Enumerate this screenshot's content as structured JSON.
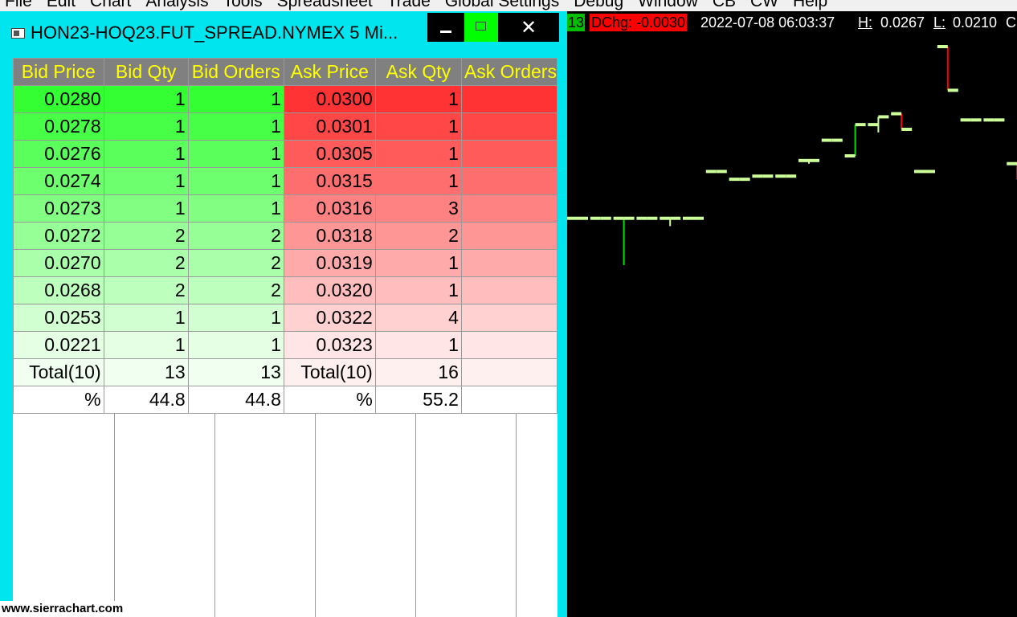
{
  "menu": [
    "File",
    "Edit",
    "Chart",
    "Analysis",
    "Tools",
    "Spreadsheet",
    "Trade",
    "Global Settings",
    "Debug",
    "Window",
    "CB",
    "CW",
    "Help"
  ],
  "window": {
    "title": "HON23-HOQ23.FUT_SPREAD.NYMEX  5 Mi...",
    "close_glyph": "✕"
  },
  "dom": {
    "headers": [
      "Bid Price",
      "Bid Qty",
      "Bid Orders",
      "Ask Price",
      "Ask Qty",
      "Ask Orders"
    ],
    "rows": [
      {
        "bid_price": "0.0280",
        "bid_qty": "1",
        "bid_orders": "1",
        "ask_price": "0.0300",
        "ask_qty": "1"
      },
      {
        "bid_price": "0.0278",
        "bid_qty": "1",
        "bid_orders": "1",
        "ask_price": "0.0301",
        "ask_qty": "1"
      },
      {
        "bid_price": "0.0276",
        "bid_qty": "1",
        "bid_orders": "1",
        "ask_price": "0.0305",
        "ask_qty": "1"
      },
      {
        "bid_price": "0.0274",
        "bid_qty": "1",
        "bid_orders": "1",
        "ask_price": "0.0315",
        "ask_qty": "1"
      },
      {
        "bid_price": "0.0273",
        "bid_qty": "1",
        "bid_orders": "1",
        "ask_price": "0.0316",
        "ask_qty": "3"
      },
      {
        "bid_price": "0.0272",
        "bid_qty": "2",
        "bid_orders": "2",
        "ask_price": "0.0318",
        "ask_qty": "2"
      },
      {
        "bid_price": "0.0270",
        "bid_qty": "2",
        "bid_orders": "2",
        "ask_price": "0.0319",
        "ask_qty": "1"
      },
      {
        "bid_price": "0.0268",
        "bid_qty": "2",
        "bid_orders": "2",
        "ask_price": "0.0320",
        "ask_qty": "1"
      },
      {
        "bid_price": "0.0253",
        "bid_qty": "1",
        "bid_orders": "1",
        "ask_price": "0.0322",
        "ask_qty": "4"
      },
      {
        "bid_price": "0.0221",
        "bid_qty": "1",
        "bid_orders": "1",
        "ask_price": "0.0323",
        "ask_qty": "1"
      }
    ],
    "total_row": {
      "bid_label": "Total(10)",
      "bid_qty": "13",
      "bid_orders": "13",
      "ask_label": "Total(10)",
      "ask_qty": "16"
    },
    "pct_row": {
      "bid_label": "%",
      "bid_qty": "44.8",
      "bid_orders": "44.8",
      "ask_label": "%",
      "ask_qty": "55.2"
    },
    "colors": {
      "bid": [
        "#33ff33",
        "#47ff47",
        "#5bff5b",
        "#6eff6e",
        "#82ff82",
        "#96ff96",
        "#aaffaa",
        "#bdffbd",
        "#d1ffd1",
        "#e5ffe5"
      ],
      "bid_total": "#f0fff0",
      "ask": [
        "#ff3333",
        "#ff4747",
        "#ff5b5b",
        "#ff6e6e",
        "#ff8282",
        "#ff9696",
        "#ffaaaa",
        "#ffbdbd",
        "#ffd1d1",
        "#ffe5e5"
      ],
      "ask_total": "#fff0f0",
      "header_bg": "#808080",
      "header_text": "#ffff00"
    }
  },
  "chart": {
    "header": {
      "volume": "13",
      "dchg": "DChg: -0.0030",
      "datetime": "2022-07-08 06:03:37",
      "high_label": "H:",
      "high_value": "0.0267",
      "low_label": "L:",
      "low_value": "0.0210",
      "extra": "C"
    },
    "watermark": "www.sierrachart.com",
    "bar_color": "#ccff99",
    "up_color": "#00dd00",
    "down_color": "#ff0000"
  },
  "chart_data": {
    "type": "ohlc",
    "bars": [
      {
        "o": 0.0213,
        "h": 0.0213,
        "l": 0.0213,
        "c": 0.0213,
        "dir": "flat"
      },
      {
        "o": 0.0213,
        "h": 0.0213,
        "l": 0.0213,
        "c": 0.0213,
        "dir": "flat"
      },
      {
        "o": 0.0213,
        "h": 0.0213,
        "l": 0.021,
        "c": 0.0213,
        "dir": "up"
      },
      {
        "o": 0.0213,
        "h": 0.0213,
        "l": 0.0213,
        "c": 0.0213,
        "dir": "flat"
      },
      {
        "o": 0.0213,
        "h": 0.0213,
        "l": 0.02125,
        "c": 0.0213,
        "dir": "flat"
      },
      {
        "o": 0.0213,
        "h": 0.0213,
        "l": 0.0213,
        "c": 0.0213,
        "dir": "flat"
      },
      {
        "o": 0.0216,
        "h": 0.0216,
        "l": 0.0216,
        "c": 0.0216,
        "dir": "flat"
      },
      {
        "o": 0.02155,
        "h": 0.02155,
        "l": 0.02155,
        "c": 0.02155,
        "dir": "flat"
      },
      {
        "o": 0.02157,
        "h": 0.02157,
        "l": 0.02157,
        "c": 0.02157,
        "dir": "flat"
      },
      {
        "o": 0.02157,
        "h": 0.02157,
        "l": 0.02157,
        "c": 0.02157,
        "dir": "flat"
      },
      {
        "o": 0.02167,
        "h": 0.02167,
        "l": 0.02165,
        "c": 0.02167,
        "dir": "flat"
      },
      {
        "o": 0.0218,
        "h": 0.0218,
        "l": 0.0218,
        "c": 0.0218,
        "dir": "flat"
      },
      {
        "o": 0.0217,
        "h": 0.0219,
        "l": 0.0217,
        "c": 0.0219,
        "dir": "up"
      },
      {
        "o": 0.0219,
        "h": 0.02195,
        "l": 0.02185,
        "c": 0.02195,
        "dir": "flat"
      },
      {
        "o": 0.02197,
        "h": 0.02197,
        "l": 0.02187,
        "c": 0.02187,
        "dir": "down"
      },
      {
        "o": 0.0216,
        "h": 0.0216,
        "l": 0.0216,
        "c": 0.0216,
        "dir": "flat"
      },
      {
        "o": 0.0224,
        "h": 0.0224,
        "l": 0.02212,
        "c": 0.02212,
        "dir": "down"
      },
      {
        "o": 0.02193,
        "h": 0.02193,
        "l": 0.02193,
        "c": 0.02193,
        "dir": "flat"
      },
      {
        "o": 0.02193,
        "h": 0.02193,
        "l": 0.02193,
        "c": 0.02193,
        "dir": "flat"
      },
      {
        "o": 0.02165,
        "h": 0.02165,
        "l": 0.02155,
        "c": 0.02155,
        "dir": "down"
      },
      {
        "o": 0.0217,
        "h": 0.0217,
        "l": 0.0217,
        "c": 0.0217,
        "dir": "flat"
      }
    ]
  }
}
